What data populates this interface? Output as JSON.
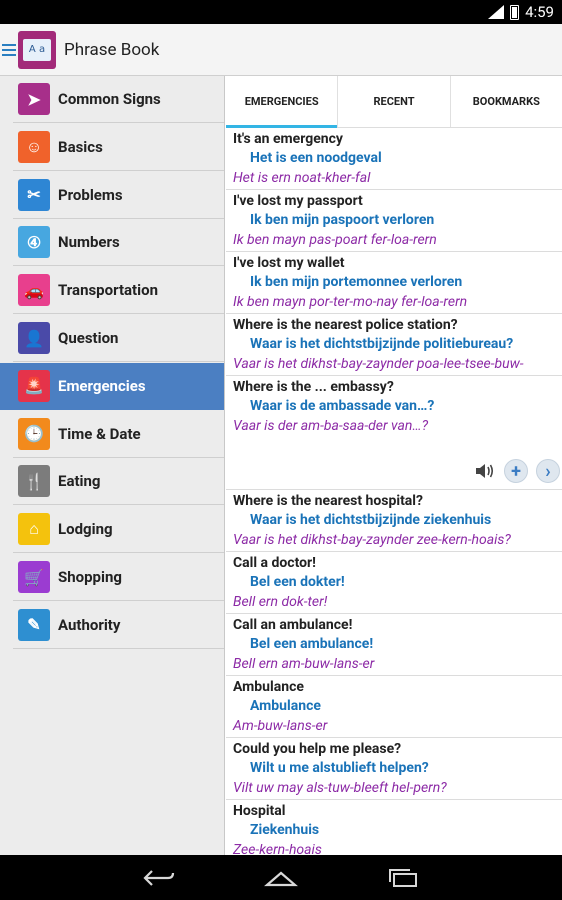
{
  "status": {
    "time": "4:59"
  },
  "app": {
    "title": "Phrase Book",
    "logo_text": "A a"
  },
  "sidebar": {
    "items": [
      {
        "label": "Common Signs",
        "icon": "sign-icon",
        "color": "#a72f8a",
        "glyph": "➤",
        "active": false
      },
      {
        "label": "Basics",
        "icon": "basics-icon",
        "color": "#f0622b",
        "glyph": "☺",
        "active": false
      },
      {
        "label": "Problems",
        "icon": "problems-icon",
        "color": "#2e86d4",
        "glyph": "✂",
        "active": false
      },
      {
        "label": "Numbers",
        "icon": "numbers-icon",
        "color": "#47a7e0",
        "glyph": "④",
        "active": false
      },
      {
        "label": "Transportation",
        "icon": "car-icon",
        "color": "#e83f8d",
        "glyph": "🚗",
        "active": false
      },
      {
        "label": "Question",
        "icon": "person-icon",
        "color": "#4a4aa8",
        "glyph": "👤",
        "active": false
      },
      {
        "label": "Emergencies",
        "icon": "siren-icon",
        "color": "#e5334a",
        "glyph": "🚨",
        "active": true
      },
      {
        "label": "Time & Date",
        "icon": "clock-icon",
        "color": "#f28a1c",
        "glyph": "🕒",
        "active": false
      },
      {
        "label": "Eating",
        "icon": "eating-icon",
        "color": "#7c7c7c",
        "glyph": "🍴",
        "active": false
      },
      {
        "label": "Lodging",
        "icon": "home-icon",
        "color": "#f4c20d",
        "glyph": "⌂",
        "active": false
      },
      {
        "label": "Shopping",
        "icon": "cart-icon",
        "color": "#9b3cd1",
        "glyph": "🛒",
        "active": false
      },
      {
        "label": "Authority",
        "icon": "authority-icon",
        "color": "#2e8fd1",
        "glyph": "✎",
        "active": false
      }
    ]
  },
  "tabs": [
    {
      "label": "EMERGENCIES",
      "active": true
    },
    {
      "label": "RECENT",
      "active": false
    },
    {
      "label": "BOOKMARKS",
      "active": false
    }
  ],
  "phrases": [
    {
      "en": "It's an emergency",
      "nl": "Het is een noodgeval",
      "pr": "Het is ern noat-kher-fal"
    },
    {
      "en": "I've lost my passport",
      "nl": "Ik ben mijn paspoort verloren",
      "pr": "Ik ben mayn pas-poart fer-loa-rern"
    },
    {
      "en": "I've lost my wallet",
      "nl": "Ik ben mijn portemonnee verloren",
      "pr": "Ik ben mayn por-ter-mo-nay fer-loa-rern"
    },
    {
      "en": "Where is the nearest police station?",
      "nl": "Waar is het dichtstbijzijnde politiebureau?",
      "pr": "Vaar is het dikhst-bay-zaynder poa-lee-tsee-buw-"
    },
    {
      "en": "Where is the ... embassy?",
      "nl": "Waar is de ambassade van…?",
      "pr": "Vaar is der am-ba-saa-der van…?",
      "expanded": true
    },
    {
      "en": "Where is the nearest hospital?",
      "nl": "Waar is het dichtstbijzijnde ziekenhuis",
      "pr": "Vaar is het dikhst-bay-zaynder zee-kern-hoais?"
    },
    {
      "en": "Call a doctor!",
      "nl": "Bel een dokter!",
      "pr": "Bell ern dok-ter!"
    },
    {
      "en": "Call an ambulance!",
      "nl": "Bel een ambulance!",
      "pr": "Bell ern am-buw-lans-er"
    },
    {
      "en": "Ambulance",
      "nl": "Ambulance",
      "pr": "Am-buw-lans-er"
    },
    {
      "en": "Could you help me please?",
      "nl": "Wilt u me alstublieft helpen?",
      "pr": "Vilt uw may als-tuw-bleeft hel-pern?"
    },
    {
      "en": "Hospital",
      "nl": "Ziekenhuis",
      "pr": "Zee-kern-hoais"
    }
  ],
  "colors": {
    "accent": "#33b5e5",
    "active_item": "#4b7fc2",
    "dutch": "#1a73b8",
    "pronunciation": "#8c2aa6"
  }
}
